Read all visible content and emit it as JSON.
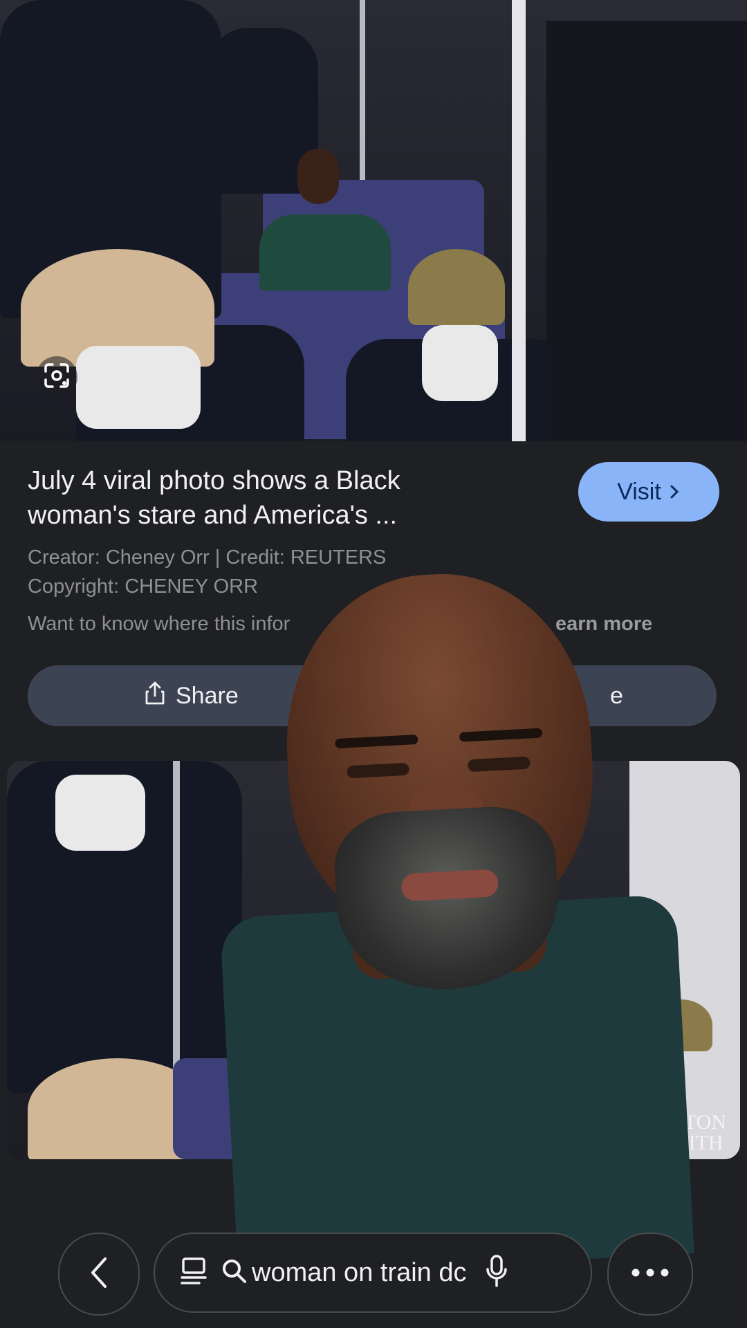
{
  "result": {
    "title": "July 4 viral photo shows a Black woman's stare and America's ...",
    "visit_label": "Visit",
    "creator_line": "Creator: Cheney Orr | Credit: REUTERS",
    "copyright_line": "Copyright: CHENEY ORR",
    "info_line": "Want to know where this infor",
    "learn_more": "earn more",
    "share_label": "Share",
    "save_fragment": "e"
  },
  "thumbnail": {
    "overlay_text_1": "GTON",
    "overlay_text_2": "WITH"
  },
  "search": {
    "query": "woman on train dc"
  },
  "icons": {
    "lens": "google-lens-icon",
    "share": "share-icon",
    "back": "chevron-left-icon",
    "tabs": "tabs-icon",
    "search": "search-icon",
    "mic": "mic-icon",
    "more": "more-horizontal-icon"
  },
  "colors": {
    "accent": "#8ab4f8",
    "background": "#1f2023",
    "button": "#3c4454"
  }
}
